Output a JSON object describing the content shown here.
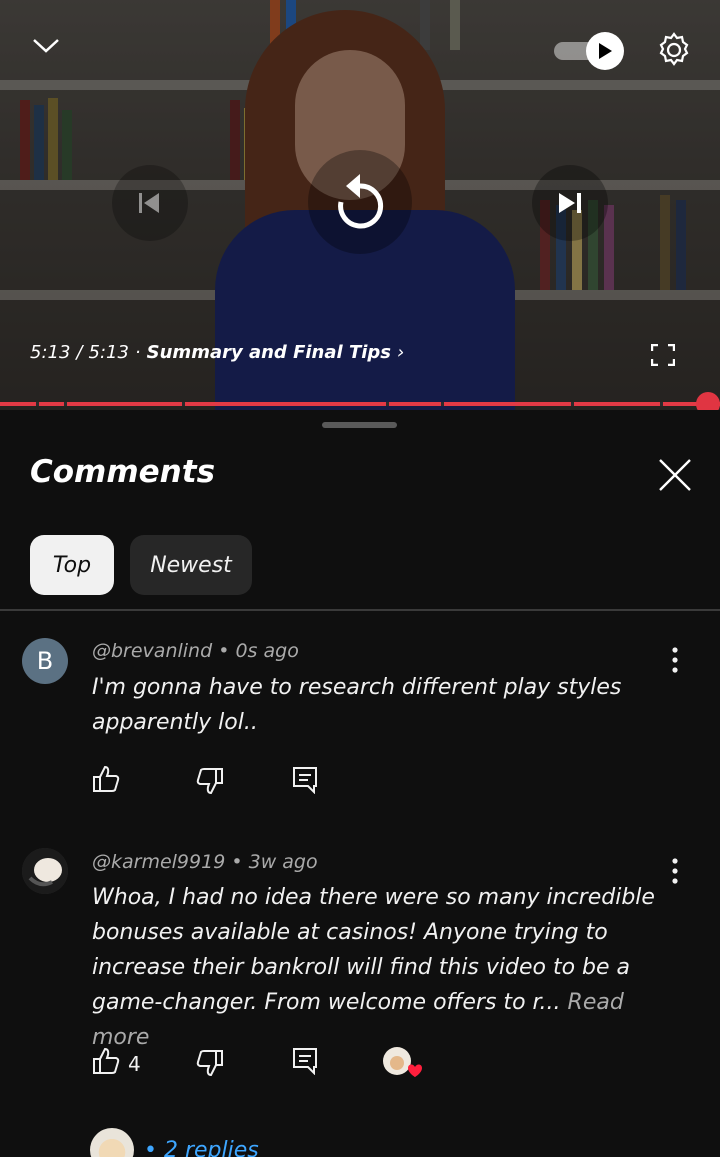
{
  "player": {
    "current_time": "5:13",
    "duration": "5:13",
    "separator": "/",
    "bullet": "·",
    "chapter": "Summary and Final Tips",
    "chapter_arrow": "›",
    "progress": 1.0,
    "accent_color": "#e23a45",
    "icons": [
      "chevron-down-icon",
      "autoplay-toggle",
      "gear-icon",
      "previous-icon",
      "replay-icon",
      "next-icon",
      "fullscreen-icon"
    ]
  },
  "sheet": {
    "title": "Comments",
    "chips": [
      {
        "label": "Top",
        "selected": true
      },
      {
        "label": "Newest",
        "selected": false
      }
    ]
  },
  "comments": [
    {
      "avatar_letter": "B",
      "author": "@brevanlind",
      "age": "0s ago",
      "text": "I'm gonna have to research different play styles apparently lol..",
      "likes": "",
      "dot": "•"
    },
    {
      "avatar_letter": "",
      "author": "@karmel9919",
      "age": "3w ago",
      "text": "Whoa, I had no idea there were so many incredible bonuses available at casinos! Anyone trying to increase their bankroll will find this video to be a game-changer. From welcome offers to r...",
      "read_more": "Read more",
      "likes": "4",
      "dot": "•",
      "creator_heart": true,
      "replies": "• 2 replies"
    }
  ]
}
